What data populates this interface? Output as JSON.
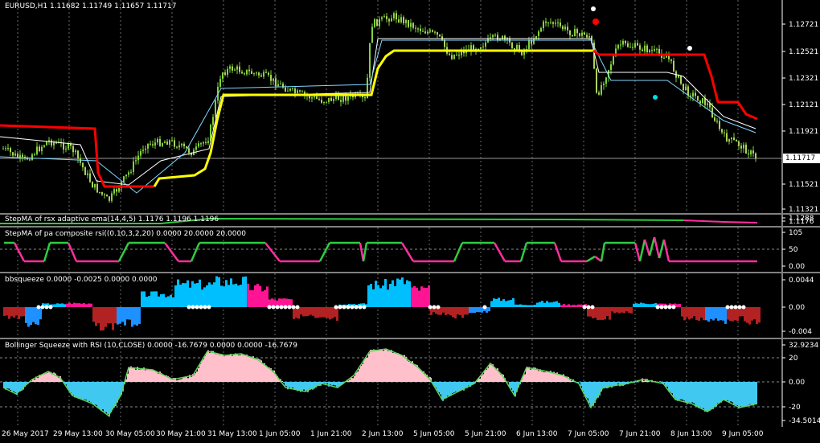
{
  "main": {
    "title": "EURUSD,H1  1.11682 1.11749 1.11657 1.11717",
    "price_levels": [
      "1.12721",
      "1.12521",
      "1.12321",
      "1.12121",
      "1.11921",
      "1.11521",
      "1.11321"
    ],
    "current_price": "1.11717"
  },
  "ind1": {
    "title": "StepMA of rsx adaptive ema(14,4,5) 1.1176 1.1196 1.1196",
    "levels": [
      "1.1288",
      "1.1176"
    ]
  },
  "ind2": {
    "title": "StepMA of pa composite rsi((0.10,3,2,20) 0.0000 20.0000 20.0000",
    "levels": [
      "105",
      "50",
      "0.00"
    ]
  },
  "ind3": {
    "title": "bbsqueeze 0.0000 -0.0025 0.0000 0.0000",
    "levels": [
      "0.0044",
      "0.00",
      "-0.004"
    ]
  },
  "ind4": {
    "title": "Bollinger Squeeze with RSI (10,CLOSE) 0.0000 -16.7679 0.0000 0.0000 -16.7679",
    "levels": [
      "32.9234",
      "20",
      "0.00",
      "-20",
      "-34.5014"
    ]
  },
  "time_axis": [
    "26 May 2017",
    "29 May 13:00",
    "30 May 05:00",
    "30 May 21:00",
    "31 May 13:00",
    "1 Jun 05:00",
    "1 Jun 21:00",
    "2 Jun 13:00",
    "5 Jun 05:00",
    "5 Jun 21:00",
    "6 Jun 13:00",
    "7 Jun 05:00",
    "7 Jun 21:00",
    "8 Jun 13:00",
    "9 Jun 05:00"
  ],
  "colors": {
    "bull": "#7fd43a",
    "bear": "#b0d060",
    "stepma_up": "#ffff00",
    "stepma_down": "#ff0000",
    "rsx_green": "#2ecc40",
    "rsx_pink": "#ff2fa0",
    "squeeze_cyan": "#00bfff",
    "squeeze_magenta": "#ff1493",
    "squeeze_red": "#b22222",
    "squeeze_blue": "#1e90ff",
    "bbrsi_pink": "#ffc0cb",
    "bbrsi_cyan": "#40c8f0"
  }
}
